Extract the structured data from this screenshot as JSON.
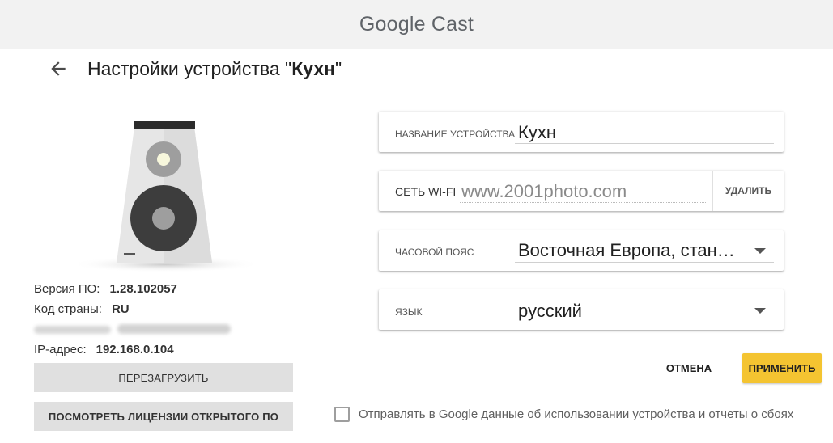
{
  "app": {
    "logo_google": "Google",
    "logo_cast": "Cast"
  },
  "header": {
    "title_prefix": "Настройки устройства \"",
    "device_name": "Кухн",
    "title_suffix": "\"",
    "back_icon": "arrow-back-icon"
  },
  "device_info": {
    "firmware_label": "Версия ПО:",
    "firmware_value": "1.28.102057",
    "country_label": "Код страны:",
    "country_value": "RU",
    "ip_label": "IP-адрес:",
    "ip_value": "192.168.0.104"
  },
  "buttons": {
    "reboot": "ПЕРЕЗАГРУЗИТЬ",
    "licenses": "ПОСМОТРЕТЬ ЛИЦЕНЗИИ ОТКРЫТОГО ПО",
    "cancel": "ОТМЕНА",
    "apply": "ПРИМЕНИТЬ"
  },
  "settings": {
    "name_label": "название устройства",
    "name_value": "Кухн",
    "wifi_label": "СЕТЬ WI-FI",
    "wifi_value": "www.2001photo.com",
    "wifi_forget": "УДАЛИТЬ",
    "timezone_label": "часовой пояс",
    "timezone_value": "Восточная Европа, стан…",
    "language_label": "язык",
    "language_value": "русский"
  },
  "consent": {
    "text": "Отправлять в Google данные об использовании устройства и отчеты о сбоях",
    "checked": false
  },
  "colors": {
    "accent": "#f4c431",
    "topbar": "#f2f2f2"
  }
}
